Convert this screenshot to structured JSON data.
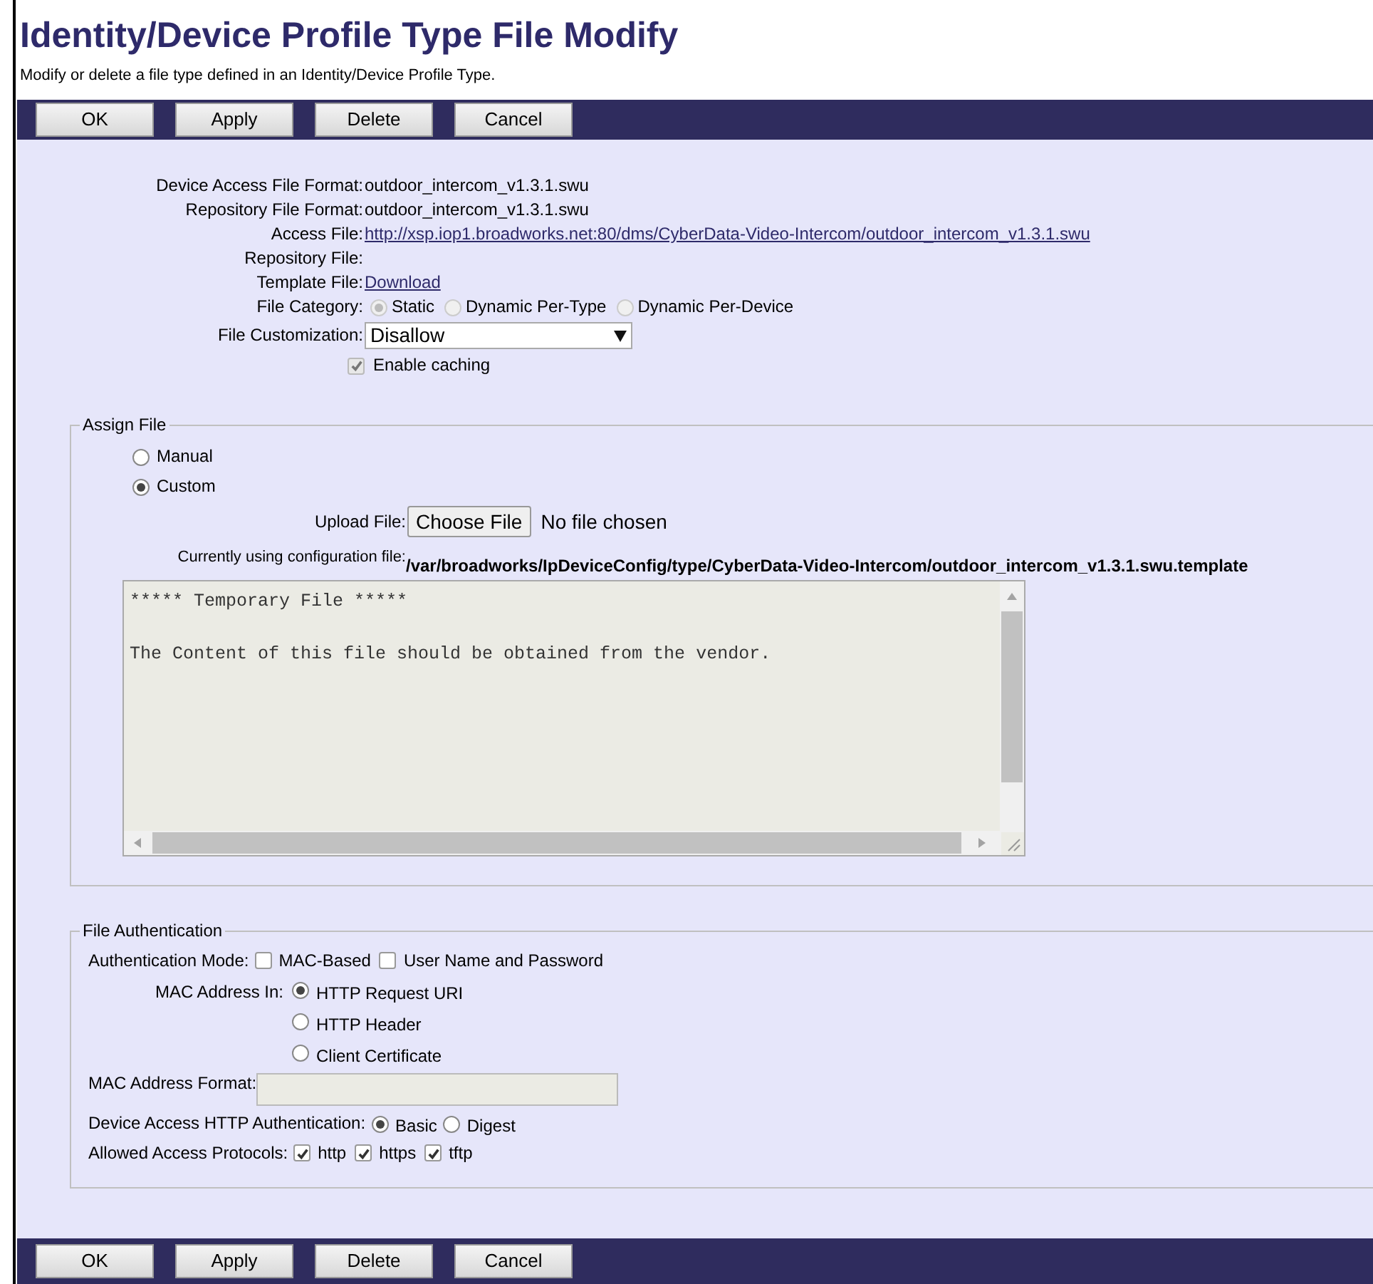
{
  "title": "Identity/Device Profile Type File Modify",
  "subtitle": "Modify or delete a file type defined in an Identity/Device Profile Type.",
  "top_buttons": [
    "OK",
    "Apply",
    "Delete",
    "Cancel"
  ],
  "fields": [
    {
      "kind": "text",
      "label": "Device Access File Format:",
      "value": "outdoor_intercom_v1.3.1.swu"
    },
    {
      "kind": "text",
      "label": "Repository File Format:",
      "value": "outdoor_intercom_v1.3.1.swu"
    },
    {
      "kind": "link",
      "label": "Access File:",
      "value": "http://xsp.iop1.broadworks.net:80/dms/CyberData-Video-Intercom/outdoor_intercom_v1.3.1.swu"
    },
    {
      "kind": "text",
      "label": "Repository File:"
    },
    {
      "kind": "link",
      "label": "Template File:",
      "value": "Download"
    },
    {
      "kind": "radios",
      "label": "File Category:",
      "disabled": true,
      "options": [
        {
          "label": "Static",
          "selected": true
        },
        {
          "label": "Dynamic Per-Type",
          "selected": false
        },
        {
          "label": "Dynamic Per-Device",
          "selected": false
        }
      ]
    },
    {
      "kind": "select",
      "label": "File Customization:",
      "value": "Disallow"
    },
    {
      "kind": "checkbox",
      "label": "Enable caching",
      "checked": true,
      "disabled": true
    }
  ],
  "assign_file": {
    "legend": "Assign File",
    "options": [
      {
        "label": "Manual",
        "selected": false
      },
      {
        "label": "Custom",
        "selected": true
      }
    ],
    "upload": {
      "label": "Upload File:",
      "button": "Choose File",
      "status": "No file chosen"
    },
    "current": {
      "label": "Currently using configuration file:",
      "value": "/var/broadworks/IpDeviceConfig/type/CyberData-Video-Intercom/outdoor_intercom_v1.3.1.swu.template"
    },
    "content": "***** Temporary File *****\n\nThe Content of this file should be obtained from the vendor."
  },
  "file_authentication": {
    "legend": "File Authentication",
    "rows": [
      {
        "kind": "checks",
        "label": "Authentication Mode:",
        "options": [
          {
            "label": "MAC-Based",
            "checked": false
          },
          {
            "label": "User Name and Password",
            "checked": false
          }
        ]
      },
      {
        "kind": "radio_stack",
        "label": "MAC Address In:",
        "options": [
          {
            "label": "HTTP Request URI",
            "selected": true
          },
          {
            "label": "HTTP Header",
            "selected": false
          },
          {
            "label": "Client Certificate",
            "selected": false
          }
        ]
      },
      {
        "kind": "input",
        "label": "MAC Address Format:"
      },
      {
        "kind": "radios",
        "label": "Device Access HTTP Authentication:",
        "options": [
          {
            "label": "Basic",
            "selected": true
          },
          {
            "label": "Digest",
            "selected": false
          }
        ]
      },
      {
        "kind": "checks",
        "label": "Allowed Access Protocols:",
        "options": [
          {
            "label": "http",
            "checked": true
          },
          {
            "label": "https",
            "checked": true
          },
          {
            "label": "tftp",
            "checked": true
          }
        ]
      }
    ]
  },
  "bottom_buttons": [
    "OK",
    "Apply",
    "Delete",
    "Cancel"
  ]
}
